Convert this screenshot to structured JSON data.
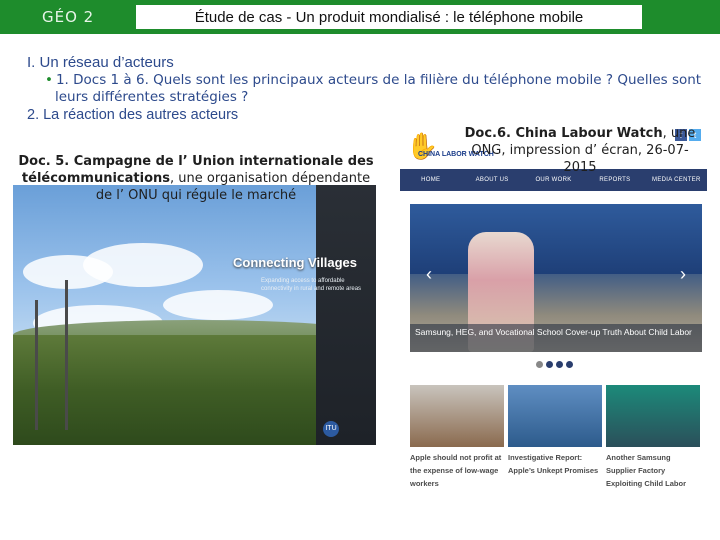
{
  "banner": {
    "label": "GÉO 2",
    "title": "Étude de cas  -  Un produit mondialisé : le téléphone mobile"
  },
  "outline": {
    "part1": "I. Un réseau d’acteurs",
    "bullet_line1": "1. Docs 1 à 6. Quels sont les principaux acteurs de la filière du téléphone mobile ? Quelles sont",
    "bullet_line2": "leurs différentes stratégies ?",
    "part2": "2. La réaction des autres acteurs"
  },
  "doc5": {
    "caption_bold": "Doc. 5. Campagne de l’ Union internationale des télécommunications",
    "caption_rest": ", une organisation dépendante de l’ ONU qui régule le marché",
    "overlay_title": "Connecting Villages",
    "overlay_subtitle": "Expanding access to affordable connectivity in rural and remote areas",
    "logo_text": "ITU"
  },
  "doc6": {
    "caption_bold": "Doc.6. China Labour Watch",
    "caption_rest": ", une ONG, impression d’ écran, 26-07-2015",
    "site": {
      "logo": "CHINA LABOR WATCH",
      "nav": [
        "HOME",
        "ABOUT US",
        "OUR WORK",
        "REPORTS",
        "MEDIA CENTER"
      ],
      "slide_caption": "Samsung, HEG, and Vocational School Cover-up Truth About Child Labor",
      "slide_count": 4,
      "slide_active": 0,
      "thumbnails": [
        {
          "caption": "Apple should not profit at the expense of low-wage workers",
          "color_top": "#c9c4bd",
          "color_bottom": "#8a6a4e"
        },
        {
          "caption": "Investigative Report: Apple’s Unkept Promises",
          "color_top": "#5f8ec2",
          "color_bottom": "#2d5b8c"
        },
        {
          "caption": "Another Samsung Supplier Factory Exploiting Child Labor",
          "color_top": "#1c8a7a",
          "color_bottom": "#2b4f5a"
        }
      ]
    }
  },
  "colors": {
    "banner": "#1e8c2c",
    "outline_text": "#2d4a8c",
    "site_nav": "#2a3e6e"
  }
}
